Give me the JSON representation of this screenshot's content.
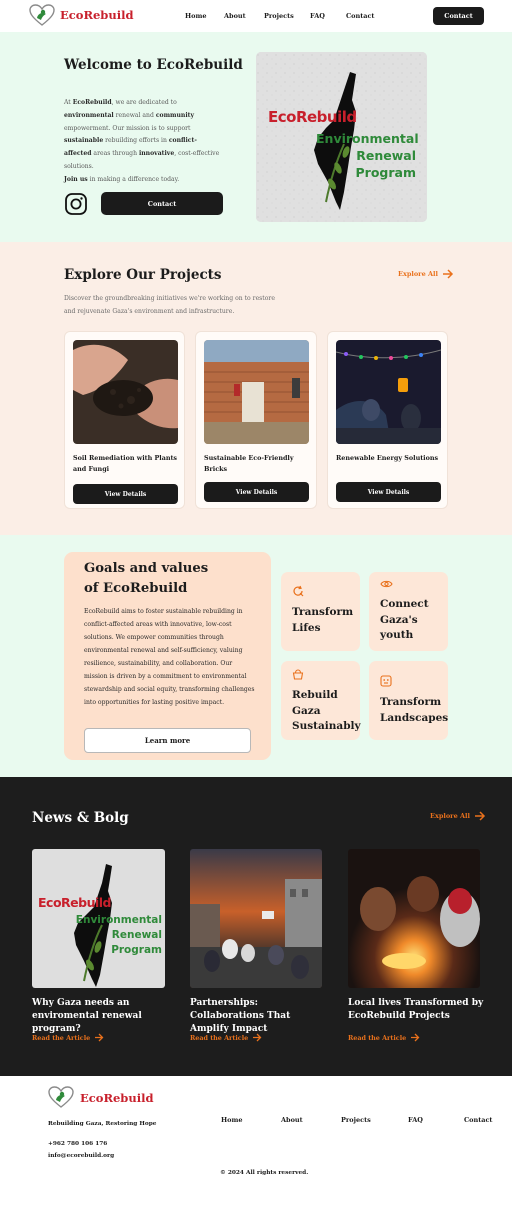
{
  "nav": {
    "brand": "EcoRebuild",
    "links": [
      "Home",
      "About",
      "Projects",
      "FAQ",
      "Contact"
    ],
    "contact_button": "Contact"
  },
  "hero": {
    "title": "Welcome to EcoRebuild",
    "paragraph_parts": [
      {
        "t": "At ",
        "b": false
      },
      {
        "t": "EcoRebuild",
        "b": true
      },
      {
        "t": ", we are dedicated to ",
        "b": false
      },
      {
        "t": "environmental",
        "b": true
      },
      {
        "t": " renewal and ",
        "b": false
      },
      {
        "t": "community",
        "b": true
      },
      {
        "t": " empowerment. Our mission is to support ",
        "b": false
      },
      {
        "t": "sustainable",
        "b": true
      },
      {
        "t": " rebuilding efforts in ",
        "b": false
      },
      {
        "t": "conflict-affected",
        "b": true
      },
      {
        "t": " areas through ",
        "b": false
      },
      {
        "t": "innovative",
        "b": true
      },
      {
        "t": ", cost-effective solutions.",
        "b": false
      }
    ],
    "join_bold": "Join us",
    "join_rest": " in making a difference today.",
    "contact_button": "Contact",
    "poster": {
      "line1": "EcoRebuild",
      "line2": "Environmental",
      "line3": "Renewal",
      "line4": "Program"
    }
  },
  "projects": {
    "title": "Explore Our Projects",
    "explore_all": "Explore All",
    "description": "Discover the groundbreaking initiatives we're working on to restore and rejuvenate Gaza's environment and infrastructure.",
    "cards": [
      {
        "title": "Soil Remediation with Plants and Fungi",
        "button": "View Details"
      },
      {
        "title": "Sustainable Eco-Friendly Bricks",
        "button": "View Details"
      },
      {
        "title": "Renewable Energy Solutions",
        "button": "View Details"
      }
    ]
  },
  "goals": {
    "title_line1": "Goals and values",
    "title_line2": "of EcoRebuild",
    "paragraph": "EcoRebuild aims to foster sustainable rebuilding in conflict-affected areas with innovative, low-cost solutions. We empower communities through environmental renewal and self-sufficiency, valuing resilience, sustainability, and collaboration. Our mission is driven by a commitment to environmental stewardship and social equity, transforming challenges into opportunities for lasting positive impact.",
    "learn_more": "Learn more",
    "tiles": [
      {
        "label": "Transform Lifes",
        "icon": "refresh-search-icon"
      },
      {
        "label": "Connect Gaza's youth",
        "icon": "eye-icon"
      },
      {
        "label": "Rebuild Gaza Sustainably",
        "icon": "basket-icon"
      },
      {
        "label": "Transform Landscapes",
        "icon": "robot-face-icon"
      }
    ],
    "accent": "#e9711c"
  },
  "news": {
    "title": "News & Bolg",
    "explore_all": "Explore All",
    "articles": [
      {
        "title": "Why Gaza needs an enviromental renewal program?",
        "link": "Read the Article"
      },
      {
        "title": "Partnerships: Collaborations That Amplify Impact",
        "link": "Read the Article"
      },
      {
        "title": "Local lives Transformed by EcoRebuild Projects",
        "link": "Read the Article"
      }
    ]
  },
  "footer": {
    "brand": "EcoRebuild",
    "tagline": "Rebuilding Gaza, Restoring Hope",
    "phone": "+962 780 106 176",
    "email": "info@ecorebuild.org",
    "links": [
      "Home",
      "About",
      "Projects",
      "FAQ",
      "Contact"
    ],
    "copyright": "© 2024 All rights reserved."
  },
  "colors": {
    "brand_red": "#c8202c",
    "accent_orange": "#e9711c",
    "mint_bg": "#e9faef",
    "peach_bg": "#fbeee6",
    "dark_bg": "#1d1d1d"
  }
}
